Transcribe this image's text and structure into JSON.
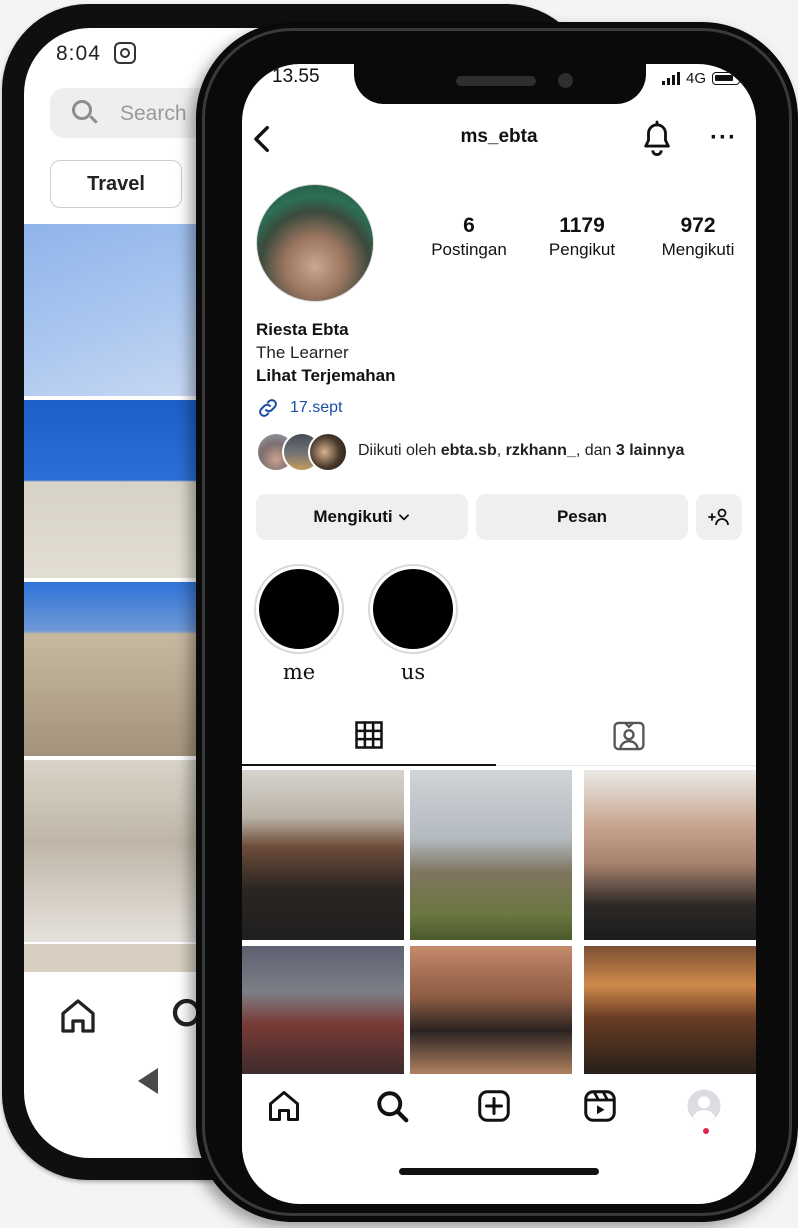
{
  "back_phone": {
    "status_time": "8:04",
    "search_placeholder": "Search",
    "chip_label": "Travel"
  },
  "status_bar": {
    "time": "13.55",
    "network": "4G"
  },
  "profile": {
    "username": "ms_ebta",
    "stats": {
      "posts_count": "6",
      "posts_label": "Postingan",
      "followers_count": "1179",
      "followers_label": "Pengikut",
      "following_count": "972",
      "following_label": "Mengikuti"
    },
    "name": "Riesta Ebta",
    "bio": "The Learner",
    "translate_label": "Lihat Terjemahan",
    "link_text": "17.sept",
    "followed_by": {
      "prefix": "Diikuti oleh ",
      "user1": "ebta.sb",
      "sep1": ", ",
      "user2": "rzkhann_",
      "sep2": ", dan ",
      "others": "3 lainnya"
    }
  },
  "actions": {
    "following_label": "Mengikuti",
    "message_label": "Pesan"
  },
  "highlights": [
    {
      "label": "me"
    },
    {
      "label": "us"
    }
  ],
  "colors": {
    "link": "#1a4ea3",
    "button_bg": "#efefef",
    "notification_dot": "#e0244a"
  },
  "icons": {
    "back": "chevron-left-icon",
    "notifications": "bell-icon",
    "more": "more-horizontal-icon",
    "link": "link-icon",
    "add_user": "add-user-icon",
    "posts_tab": "grid-icon",
    "tagged_tab": "tagged-user-icon",
    "nav": [
      "home-icon",
      "search-icon",
      "add-post-icon",
      "reels-icon",
      "profile-avatar-icon"
    ]
  }
}
